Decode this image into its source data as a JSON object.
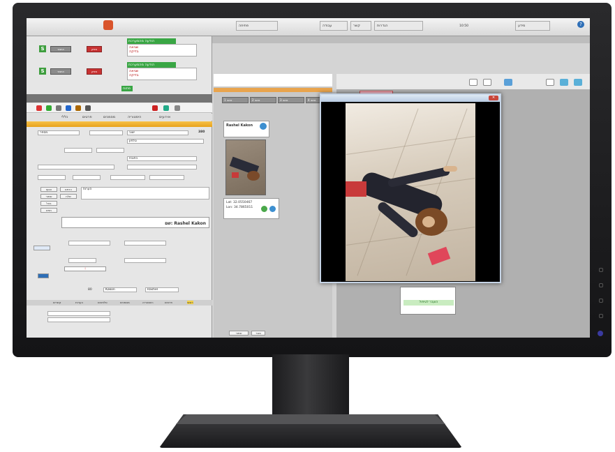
{
  "app": {
    "help_label": "?",
    "top_tabs": [
      "פתיחה",
      "עבודה",
      "קשר",
      "הגדרות",
      "מידע"
    ],
    "logo_label": "",
    "clock": "10:50"
  },
  "left_panel": {
    "alerts": [
      {
        "title": "הודעה מהמערכת",
        "lines": [
          "שגיאה",
          "בדיקה"
        ],
        "button_red": "מחק",
        "button_gray": "אישור",
        "s_label": "S"
      },
      {
        "title": "הודעה מהמערכת",
        "lines": [
          "שגיאה",
          "בדיקה"
        ],
        "button_red": "מחק",
        "button_gray": "אישור",
        "s_label": "S"
      }
    ],
    "green_status": "פתוח",
    "tabs": [
      "כללי",
      "פרטים",
      "מסמכים",
      "היסטוריה",
      "אירועים"
    ],
    "form": {
      "id_label": "מס'",
      "id_value": "380",
      "fields": [
        "ישוב",
        "רחוב",
        "טלפון",
        "כתובת",
        "מספר"
      ],
      "notes_label": "הערות",
      "first_name": "Rashel",
      "last_name": "Kakon",
      "name_display": "שם: Rashel Kakon",
      "age": "80"
    },
    "action_buttons": [
      "הוסף",
      "שמור",
      "בטל",
      "חפש",
      "הדפס",
      "שלח"
    ],
    "bottom_tabs": [
      "ראשי",
      "פרטים",
      "היסטוריה",
      "מסמכים",
      "טלפונים",
      "הערות",
      "קשרים"
    ]
  },
  "middle_panel": {
    "tabs": [
      "טאב 1",
      "טאב 2",
      "טאב 3",
      "טאב 4"
    ],
    "card_name": "Rashel Kakon",
    "coords": [
      "Lat: 32.0550467",
      "Lon: 34.7865011"
    ],
    "bottom_buttons": [
      "שמור",
      "סגור"
    ]
  },
  "right_panel": {
    "pink_label": "נבדק ידנית",
    "green_tag": "הועבר לטיפול"
  },
  "popup": {
    "title": "",
    "close_label": "✕"
  },
  "colors": {
    "accent_green": "#39a644",
    "alert_red": "#c83232",
    "orange_bar": "#e8a21b",
    "help_blue": "#2e6fb7"
  }
}
